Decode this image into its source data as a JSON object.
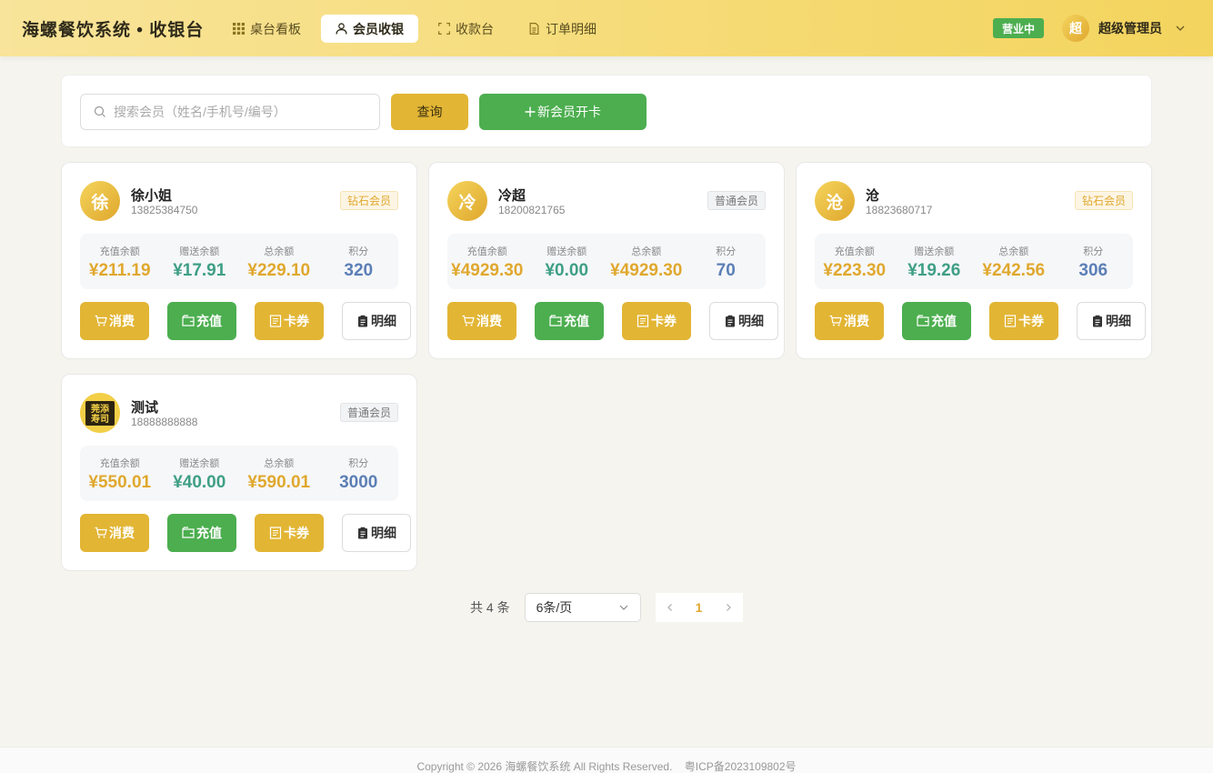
{
  "header": {
    "brand": "海螺餐饮系统 • 收银台",
    "nav": [
      {
        "label": "桌台看板",
        "icon": "grid-icon"
      },
      {
        "label": "会员收银",
        "icon": "user-icon"
      },
      {
        "label": "收款台",
        "icon": "scan-icon"
      },
      {
        "label": "订单明细",
        "icon": "document-icon"
      }
    ],
    "active_nav": "会员收银",
    "status": "营业中",
    "avatar_char": "超",
    "user_name": "超级管理员",
    "colors": {
      "accent": "#e2b534",
      "green": "#4cae4f",
      "header_from": "#f8e49a",
      "header_to": "#f3d45e"
    }
  },
  "search": {
    "placeholder": "搜索会员（姓名/手机号/编号）",
    "value": "",
    "query_label": "查询",
    "new_label": "新会员开卡"
  },
  "stat_labels": {
    "recharge": "充值余额",
    "bonus": "赠送余额",
    "total": "总余额",
    "points": "积分"
  },
  "action_labels": {
    "consume": "消费",
    "recharge": "充值",
    "coupon": "卡券",
    "detail": "明细"
  },
  "members": [
    {
      "avatar_char": "徐",
      "name": "徐小姐",
      "phone": "13825384750",
      "level": "钻石会员",
      "level_type": "diamond",
      "recharge": "¥211.19",
      "bonus": "¥17.91",
      "total": "¥229.10",
      "points": "320"
    },
    {
      "avatar_char": "冷",
      "name": "冷超",
      "phone": "18200821765",
      "level": "普通会员",
      "level_type": "normal",
      "recharge": "¥4929.30",
      "bonus": "¥0.00",
      "total": "¥4929.30",
      "points": "70"
    },
    {
      "avatar_char": "沧",
      "name": "沧",
      "phone": "18823680717",
      "level": "钻石会员",
      "level_type": "diamond",
      "recharge": "¥223.30",
      "bonus": "¥19.26",
      "total": "¥242.56",
      "points": "306"
    },
    {
      "avatar_char": "",
      "avatar_logo_text": [
        "莞添",
        "寿司"
      ],
      "name": "测试",
      "phone": "18888888888",
      "level": "普通会员",
      "level_type": "normal",
      "recharge": "¥550.01",
      "bonus": "¥40.00",
      "total": "¥590.01",
      "points": "3000"
    }
  ],
  "pagination": {
    "total_text": "共 4 条",
    "page_size": "6条/页",
    "current_page": "1"
  },
  "footer": {
    "copyright": "Copyright © 2026 海螺餐饮系统 All Rights Reserved.",
    "icp": "粤ICP备2023109802号"
  }
}
